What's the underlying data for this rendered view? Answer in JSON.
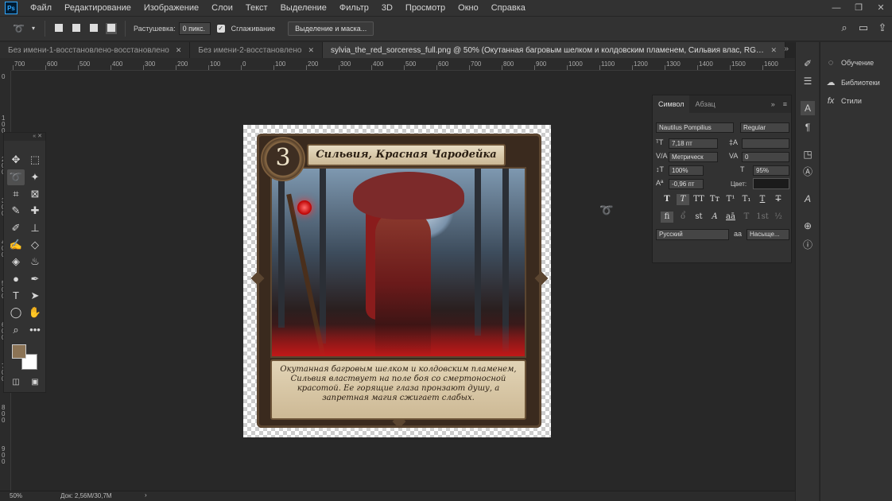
{
  "app": {
    "logo": "Ps"
  },
  "menu": [
    "Файл",
    "Редактирование",
    "Изображение",
    "Слои",
    "Текст",
    "Выделение",
    "Фильтр",
    "3D",
    "Просмотр",
    "Окно",
    "Справка"
  ],
  "window_controls": {
    "minimize": "—",
    "restore": "❐",
    "close": "✕"
  },
  "options": {
    "feather_label": "Растушевка:",
    "feather_value": "0 пикс.",
    "antialias_label": "Сглаживание",
    "select_mask_button": "Выделение и маска..."
  },
  "tabs": [
    {
      "label": "Без имени-1-восстановлено-восстановлено",
      "close": "✕"
    },
    {
      "label": "Без имени-2-восстановлено",
      "close": "✕"
    },
    {
      "label": "sylvia_the_red_sorceress_full.png @ 50% (Окутанная багровым шелком и колдовским пламенем,  Сильвия влас, RGB/8*) *",
      "close": "✕"
    }
  ],
  "tabs_more": "»",
  "ruler_top": [
    "700",
    "600",
    "500",
    "400",
    "300",
    "200",
    "100",
    "0",
    "100",
    "200",
    "300",
    "400",
    "500",
    "600",
    "700",
    "800",
    "900",
    "1000",
    "1100",
    "1200",
    "1300",
    "1400",
    "1500",
    "1600"
  ],
  "ruler_left": [
    "0",
    "1 0 0",
    "2 0 0",
    "3 0 0",
    "4 0 0",
    "5 0 0",
    "6 0 0",
    "7 0 0",
    "8 0 0",
    "9 0 0"
  ],
  "card": {
    "cost": "3",
    "title": "Сильвия, Красная Чародейка",
    "text": "Окутанная багровым шелком и колдовским пламенем, Сильвия властвует на поле боя со смертоносной красотой. Ее горящие глаза пронзают душу, а запретная магия сжигает слабых."
  },
  "character_panel": {
    "tab_character": "Символ",
    "tab_paragraph": "Абзац",
    "collapse": "»",
    "menu": "≡",
    "font_family": "Nautilus Pompilius",
    "font_style": "Regular",
    "font_size": "7,18 пт",
    "leading": "",
    "kerning": "Метрическ",
    "tracking": "0",
    "vscale": "100%",
    "hscale": "95%",
    "baseline": "-0,96 пт",
    "color_label": "Цвет:",
    "language": "Русский",
    "antialias": "Насыще...",
    "aa_icon": "aa"
  },
  "right_panel": [
    {
      "icon": "lightbulb-icon",
      "glyph": "💡",
      "label": "Обучение"
    },
    {
      "icon": "libraries-icon",
      "glyph": "☁",
      "label": "Библиотеки"
    },
    {
      "icon": "styles-icon",
      "glyph": "fx",
      "label": "Стили"
    }
  ],
  "status": {
    "zoom": "50%",
    "doc": "Док: 2,56M/30,7M",
    "arrow": "›"
  },
  "colors": {
    "foreground": "#8b7355",
    "background": "#ffffff",
    "accent": "#31a8ff"
  }
}
